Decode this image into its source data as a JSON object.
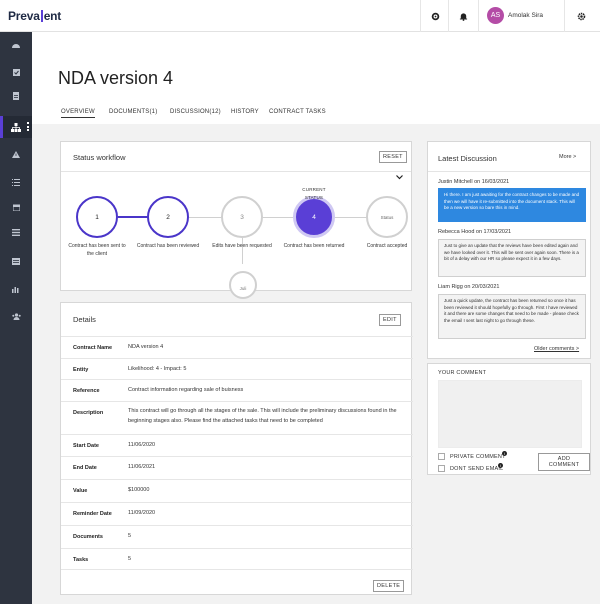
{
  "brand": {
    "logo_left": "Preva",
    "logo_right": "ent"
  },
  "user": {
    "initials": "AS",
    "name": "Amolak Sira"
  },
  "page": {
    "title": "NDA version 4"
  },
  "tabs": [
    {
      "label": "OVERVIEW"
    },
    {
      "label": "DOCUMENTS(1)"
    },
    {
      "label": "DISCUSSION(12)"
    },
    {
      "label": "HISTORY"
    },
    {
      "label": "CONTRACT TASKS"
    }
  ],
  "workflow": {
    "title": "Status workflow",
    "reset_label": "RESET",
    "current_status_label": "CURRENT STATUS",
    "steps": [
      {
        "num": "1",
        "label": "Contract has been sent to the client"
      },
      {
        "num": "2",
        "label": "Contract has been reviewed"
      },
      {
        "num": "3",
        "label": "Edits have been requested"
      },
      {
        "num": "4",
        "label": "Contract has been returned"
      },
      {
        "num": "Status",
        "label": "Contract accepted"
      }
    ],
    "partial_step": "Juli"
  },
  "details": {
    "title": "Details",
    "edit_label": "EDIT",
    "delete_label": "DELETE",
    "rows": [
      {
        "key": "Contract Name",
        "value": "NDA version 4"
      },
      {
        "key": "Entity",
        "value": "Likelihood: 4 - Impact: 5"
      },
      {
        "key": "Reference",
        "value": "Contract information regarding sale of buisness"
      },
      {
        "key": "Description",
        "value": "This contract will go through all the stages of the sale. This will include the preliminary discussions found in the beginning stages also. Please find the attached tasks that need to be completed"
      },
      {
        "key": "Start Date",
        "value": "11/06/2020"
      },
      {
        "key": "End Date",
        "value": "11/06/2021"
      },
      {
        "key": "Value",
        "value": "$100000"
      },
      {
        "key": "Reminder Date",
        "value": "11/09/2020"
      },
      {
        "key": "Documents",
        "value": "5"
      },
      {
        "key": "Tasks",
        "value": "5"
      }
    ]
  },
  "discussion": {
    "title": "Latest Discussion",
    "more_label": "More >",
    "messages": [
      {
        "author": "Justin Mitchell on 16/03/2021",
        "text": "Hi there. I am just awaiting for the contract changes to be made and then we will have it re-submitted into the document stack. This will be a new version so bare this in mind."
      },
      {
        "author": "Rebecca Hood on 17/03/2021",
        "text": "Just to give an update that the reviews have been edited again and we have looked over it. This will be sent over again soon. There is a bit of a delay with our HR so please expect it in a few days."
      },
      {
        "author": "Liam Rigg on 20/03/2021",
        "text": "Just a quick update, the contract has been returned so once it has been reviewed it should hopefully go through. First I have reviewed it and there are some changes that need to be made - please check the email I sent last night to go through these."
      }
    ],
    "older_label": "Older comments >"
  },
  "comment": {
    "label": "YOUR COMMENT",
    "private_label": "PRIVATE COMMENT",
    "no_email_label": "DONT SEND EMAIL",
    "add_label": "ADD COMMENT"
  },
  "colors": {
    "accent": "#5a3fd6",
    "sidebar": "#2e3440",
    "bubble_me": "#2e88e0"
  }
}
